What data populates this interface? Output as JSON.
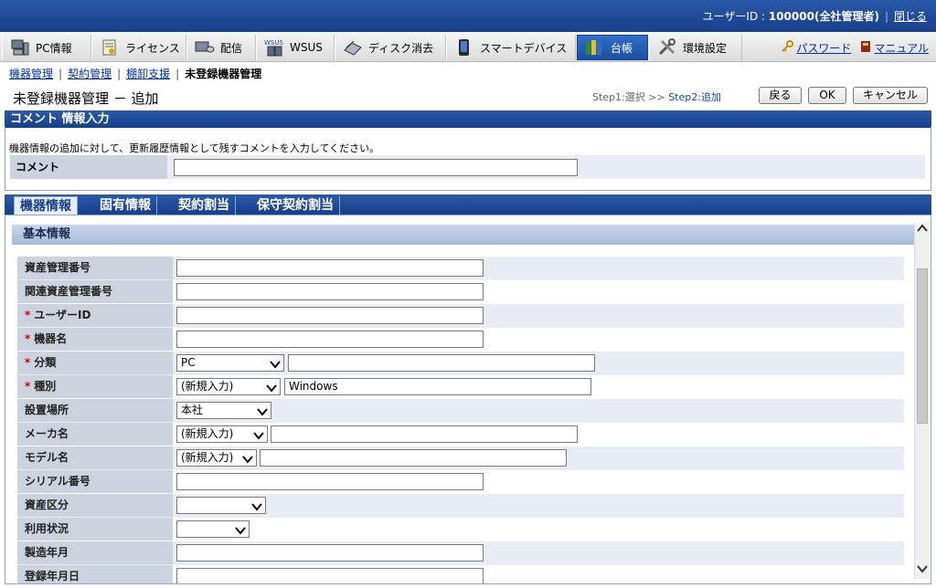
{
  "topbar": {
    "user_label": "ユーザーID : ",
    "user_value": "100000(全社管理者)",
    "close": "閉じる"
  },
  "menu": {
    "items": [
      {
        "label": "PC情報",
        "icon": "pc-icon"
      },
      {
        "label": "ライセンス",
        "icon": "license-icon"
      },
      {
        "label": "配信",
        "icon": "distribution-icon"
      },
      {
        "label": "WSUS",
        "icon": "wsus-icon"
      },
      {
        "label": "ディスク消去",
        "icon": "disk-erase-icon"
      },
      {
        "label": "スマートデバイス",
        "icon": "smart-device-icon"
      },
      {
        "label": "台帳",
        "icon": "ledger-icon"
      },
      {
        "label": "環境設定",
        "icon": "settings-icon"
      }
    ],
    "password": "パスワード",
    "manual": "マニュアル"
  },
  "breadcrumb": {
    "items": [
      "機器管理",
      "契約管理",
      "棚卸支援"
    ],
    "current": "未登録機器管理"
  },
  "page": {
    "title": "未登録機器管理 － 追加",
    "step1": "Step1:選択",
    "arrow": ">>",
    "step2": "Step2:追加",
    "back": "戻る",
    "ok": "OK",
    "cancel": "キャンセル"
  },
  "comment": {
    "header": "コメント 情報入力",
    "description": "機器情報の追加に対して、更新履歴情報として残すコメントを入力してください。",
    "label": "コメント",
    "value": ""
  },
  "tabs": [
    "機器情報",
    "固有情報",
    "契約割当",
    "保守契約割当"
  ],
  "basic": {
    "header": "基本情報",
    "required_mark": "*",
    "rows": [
      {
        "label": "資産管理番号",
        "required": false,
        "text": ""
      },
      {
        "label": "関連資産管理番号",
        "required": false,
        "text": ""
      },
      {
        "label": "ユーザーID",
        "required": true,
        "text": ""
      },
      {
        "label": "機器名",
        "required": true,
        "text": ""
      },
      {
        "label": "分類",
        "required": true,
        "select": "PC",
        "text": ""
      },
      {
        "label": "種別",
        "required": true,
        "select": "(新規入力)",
        "text": "Windows"
      },
      {
        "label": "設置場所",
        "required": false,
        "select": "本社"
      },
      {
        "label": "メーカ名",
        "required": false,
        "select": "(新規入力)",
        "text": ""
      },
      {
        "label": "モデル名",
        "required": false,
        "select": "(新規入力)",
        "text": ""
      },
      {
        "label": "シリアル番号",
        "required": false,
        "text": ""
      },
      {
        "label": "資産区分",
        "required": false,
        "select": ""
      },
      {
        "label": "利用状況",
        "required": false,
        "select": ""
      },
      {
        "label": "製造年月",
        "required": false,
        "text": ""
      },
      {
        "label": "登録年月日",
        "required": false,
        "text": ""
      }
    ]
  }
}
